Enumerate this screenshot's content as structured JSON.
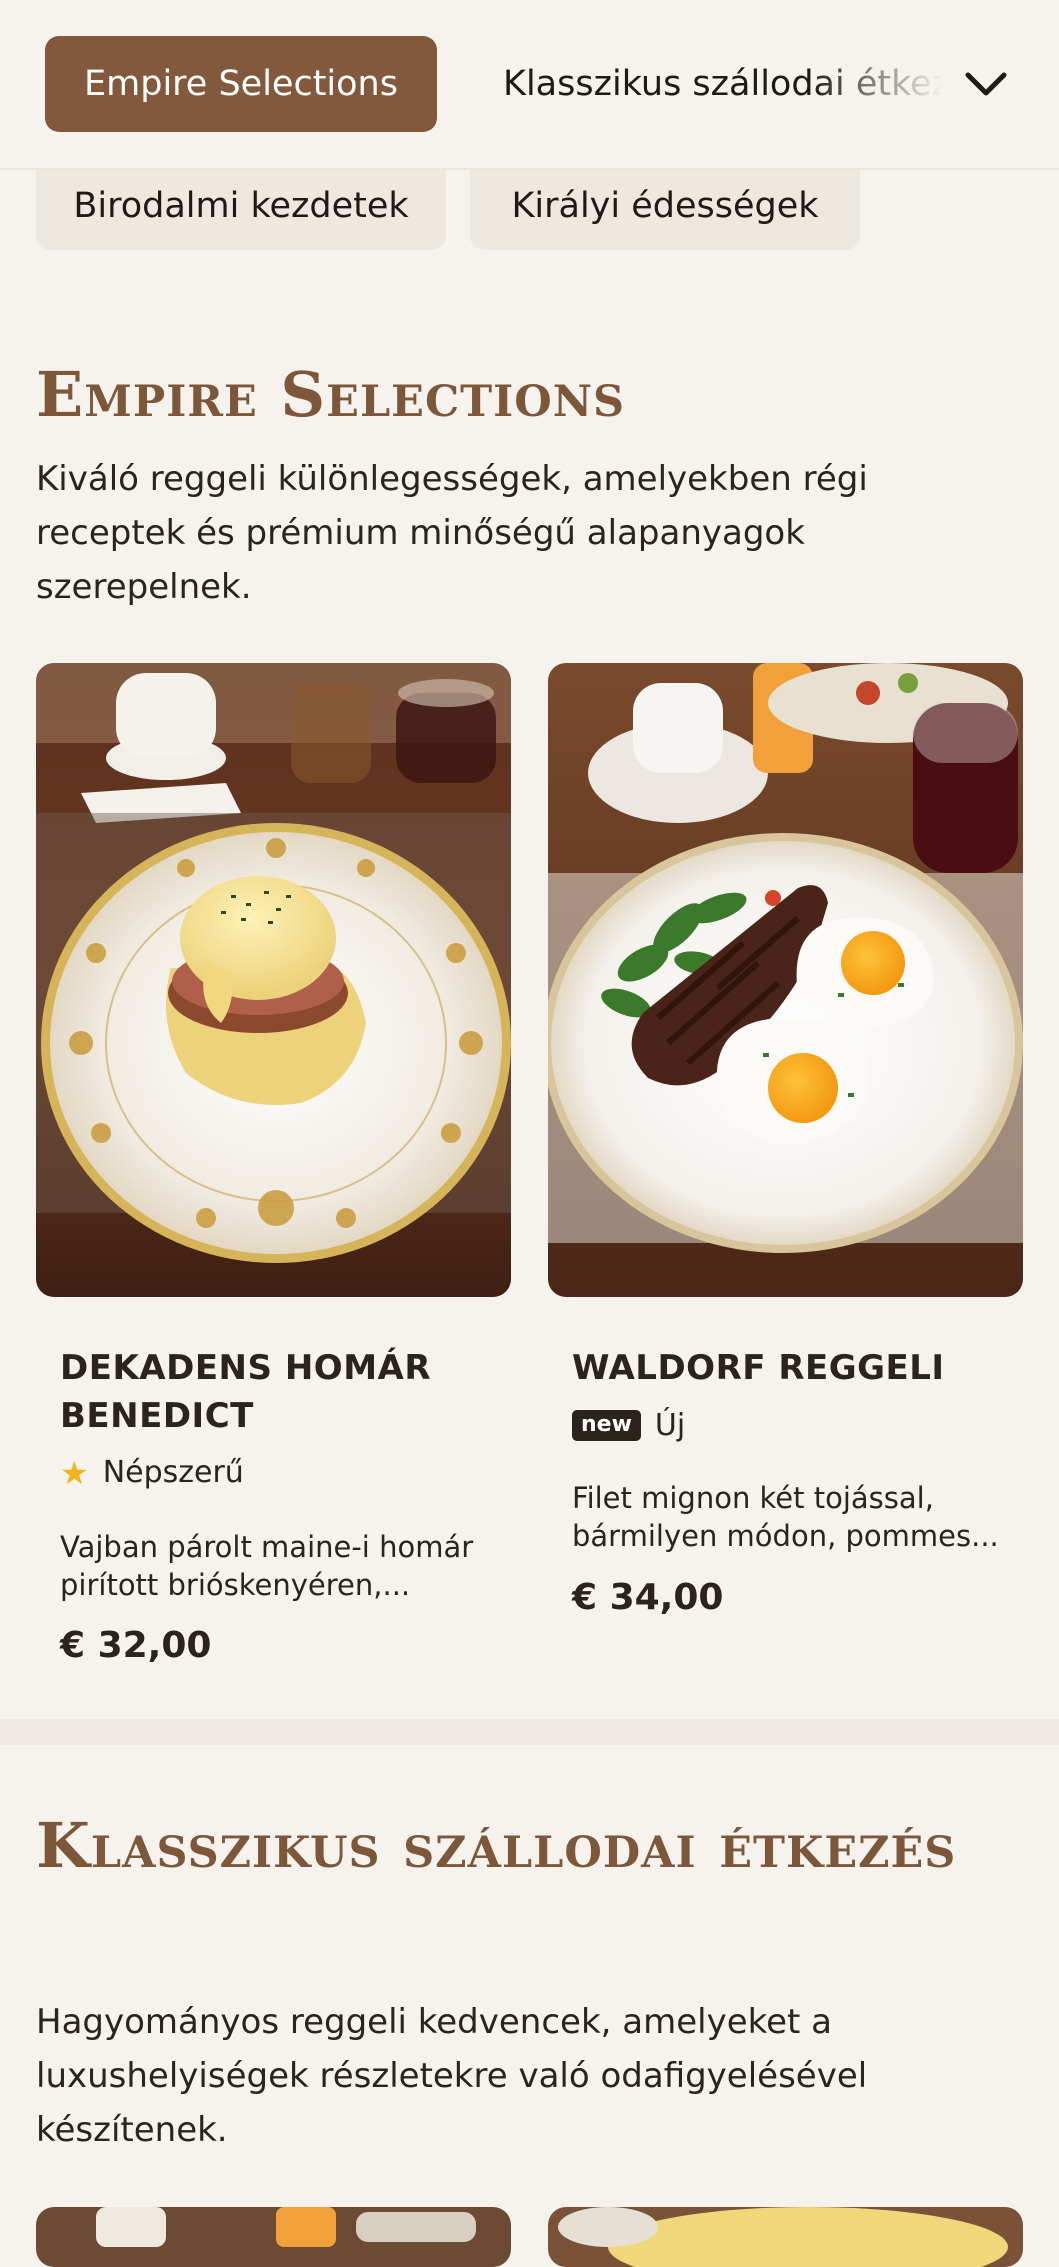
{
  "nav": {
    "active_label": "Empire Selections",
    "next_label": "Klasszikus szállodai étkezés",
    "expand_icon": "chevron-down-icon"
  },
  "subnav": {
    "chips": [
      "Birodalmi kezdetek",
      "Királyi édességek"
    ]
  },
  "sections": [
    {
      "title": "Empire Selections",
      "description": "Kiváló reggeli különlegességek, amelyekben régi receptek és prémium minőségű alapanyagok szerepelnek.",
      "items": [
        {
          "name": "DEKADENS HOMÁR BENEDICT",
          "badge_icon": "star-icon",
          "badge_label": "Népszerű",
          "description": "Vajban párolt maine-i homár pirított brióskenyéren,...",
          "price": "€ 32,00",
          "image": "eggs-benedict-photo"
        },
        {
          "name": "WALDORF REGGELI",
          "badge_icon": "new-badge",
          "badge_tag": "new",
          "badge_label": "Új",
          "description": "Filet mignon két tojással, bármilyen módon, pommes...",
          "price": "€ 34,00",
          "image": "steak-and-eggs-photo"
        }
      ]
    },
    {
      "title": "Klasszikus szállodai étkezés",
      "description": "Hagyományos reggeli kedvencek, amelyeket a luxushelyiségek részletekre való odafigyelésével készítenek."
    }
  ],
  "colors": {
    "brand": "#82593c",
    "heading": "#7d573a",
    "background": "#f6f3ee",
    "star": "#f2b418"
  }
}
